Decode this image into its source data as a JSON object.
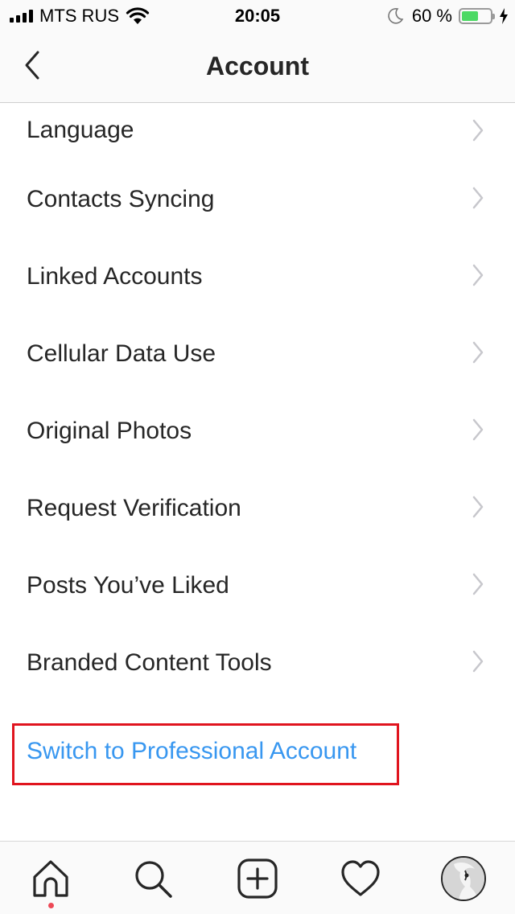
{
  "status_bar": {
    "carrier": "MTS RUS",
    "time": "20:05",
    "battery_percent": "60 %",
    "battery_level": 0.6,
    "icons": [
      "signal-icon",
      "wifi-icon",
      "moon-icon",
      "battery-icon",
      "charging-bolt-icon"
    ]
  },
  "header": {
    "title": "Account",
    "back_icon": "chevron-left-icon"
  },
  "menu": {
    "items": [
      {
        "label": "Language"
      },
      {
        "label": "Contacts Syncing"
      },
      {
        "label": "Linked Accounts"
      },
      {
        "label": "Cellular Data Use"
      },
      {
        "label": "Original Photos"
      },
      {
        "label": "Request Verification"
      },
      {
        "label": "Posts You’ve Liked"
      },
      {
        "label": "Branded Content Tools"
      }
    ],
    "switch_professional": "Switch to Professional Account"
  },
  "tab_bar": {
    "tabs": [
      "home-icon",
      "search-icon",
      "new-post-icon",
      "activity-heart-icon",
      "profile-avatar"
    ],
    "active": "home-icon",
    "notification_dot_color": "#ed4956"
  },
  "colors": {
    "accent_link": "#3897f0",
    "highlight_box": "#e0141e",
    "text": "#262626",
    "battery_fill": "#4cd964"
  }
}
